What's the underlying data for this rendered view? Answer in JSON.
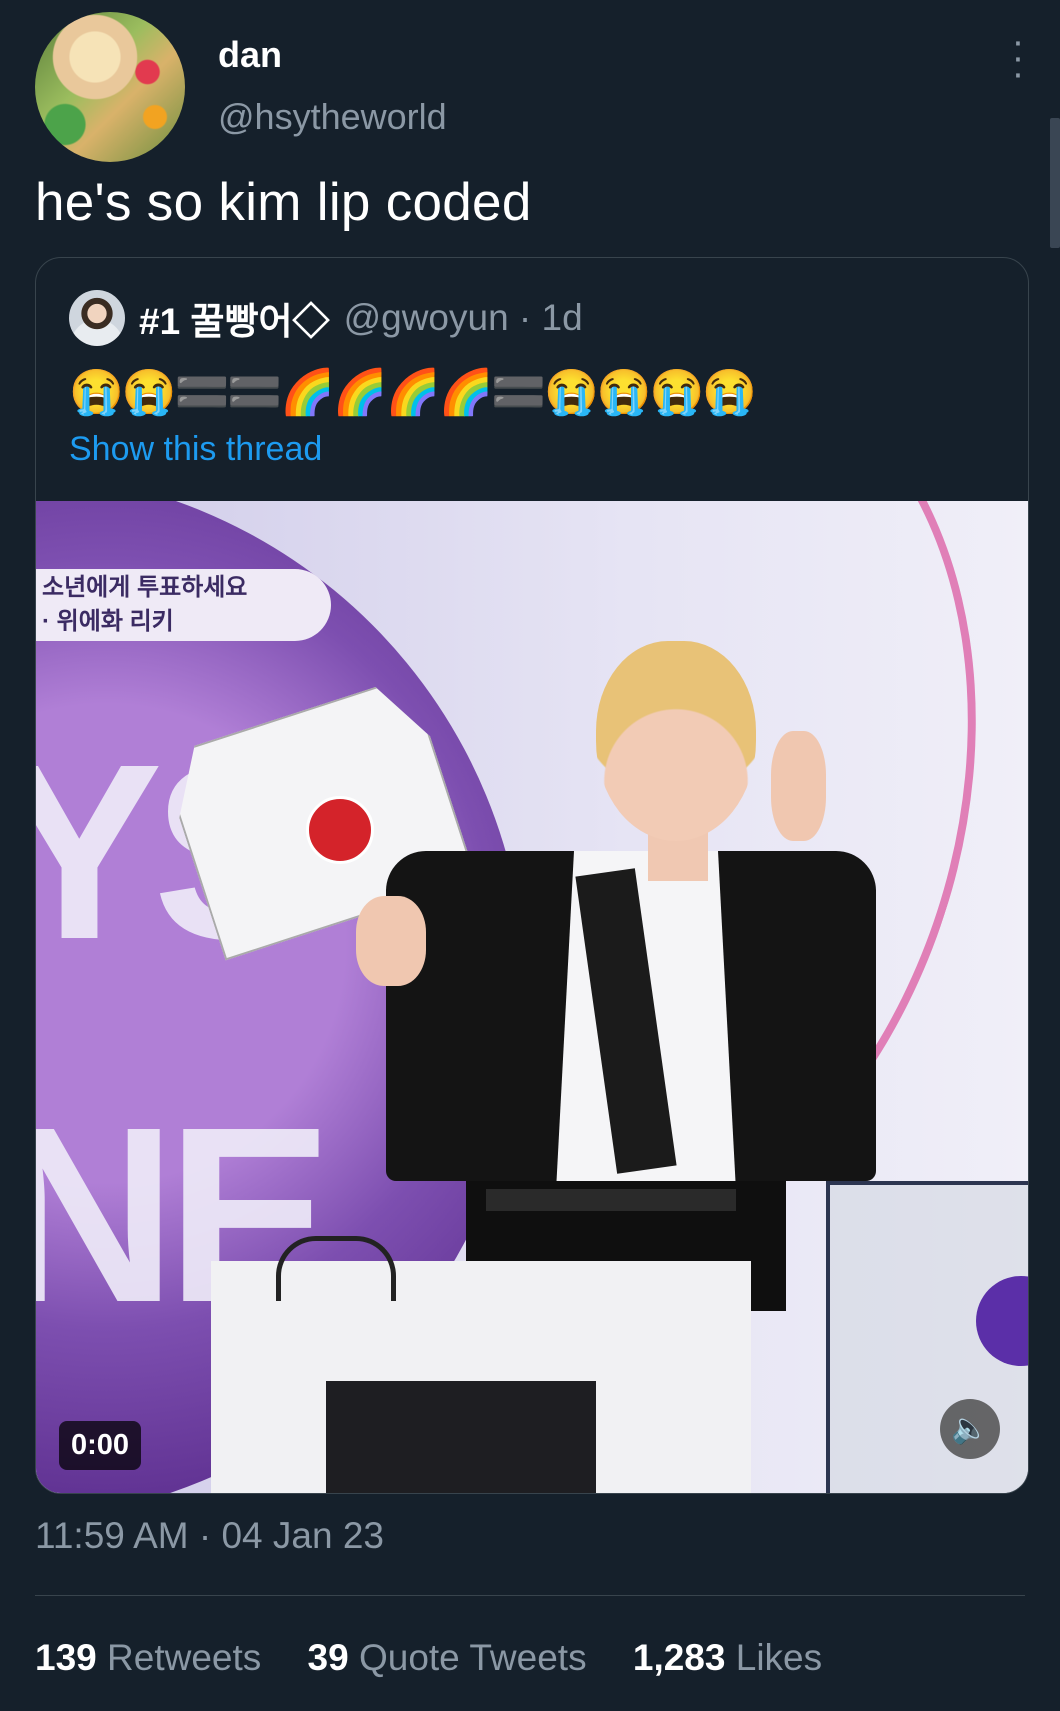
{
  "author": {
    "name": "dan",
    "handle": "@hsytheworld"
  },
  "tweet": {
    "text": "he's so kim lip coded"
  },
  "quoted": {
    "name": "#1 꿀빵어◇",
    "handle_time": "@gwoyun · 1d",
    "emoji": "😭😭🟰🟰🌈🌈🌈🌈🟰😭😭😭😭",
    "show_thread": "Show this thread",
    "media": {
      "banner_line1": "소년에게 투표하세요",
      "banner_line2": "· 위에화 리키",
      "bg_letters": "YS\nNE",
      "duration": "0:00"
    }
  },
  "meta": {
    "timestamp": "11:59 AM · 04 Jan 23"
  },
  "stats": {
    "retweets_count": "139",
    "retweets_label": "Retweets",
    "quotes_count": "39",
    "quotes_label": "Quote Tweets",
    "likes_count": "1,283",
    "likes_label": "Likes"
  }
}
